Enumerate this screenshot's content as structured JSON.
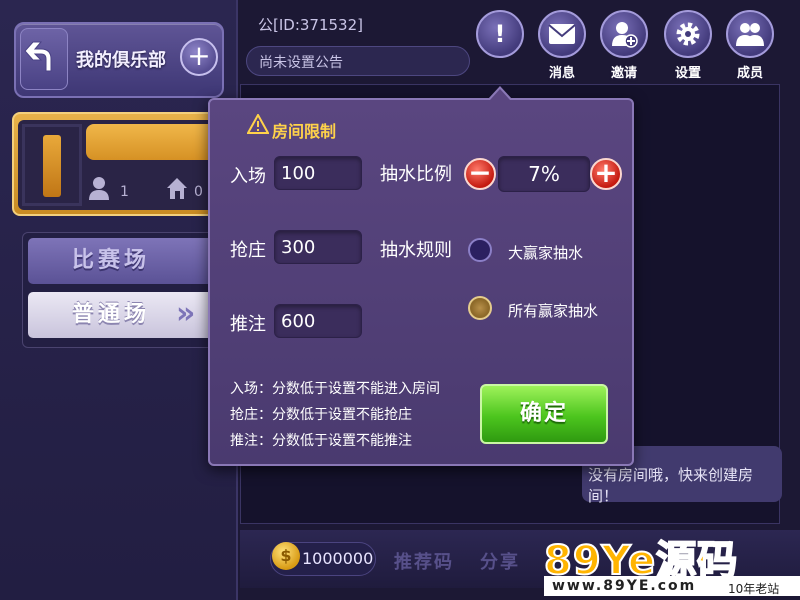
{
  "sidebar": {
    "title": "我的俱乐部",
    "member_count": "1",
    "room_count": "0",
    "modes": [
      "比赛场",
      "普通场"
    ]
  },
  "header": {
    "club_id": "公[ID:371532]",
    "announcement": "尚未设置公告",
    "icons": [
      {
        "name": "notice-icon",
        "label": ""
      },
      {
        "name": "mail-icon",
        "label": "消息"
      },
      {
        "name": "invite-icon",
        "label": "邀请"
      },
      {
        "name": "settings-icon",
        "label": "设置"
      },
      {
        "name": "members-icon",
        "label": "成员"
      }
    ]
  },
  "dialog": {
    "title": "房间限制",
    "fields": {
      "entry": {
        "label": "入场",
        "value": "100"
      },
      "banker": {
        "label": "抢庄",
        "value": "300"
      },
      "bet": {
        "label": "推注",
        "value": "600"
      }
    },
    "rake_ratio_label": "抽水比例",
    "rake_ratio_value": "7%",
    "rake_rule_label": "抽水规则",
    "rake_rules": [
      {
        "label": "大赢家抽水",
        "selected": false
      },
      {
        "label": "所有赢家抽水",
        "selected": true
      }
    ],
    "notes": [
      "入场：分数低于设置不能进入房间",
      "抢庄：分数低于设置不能抢庄",
      "推注：分数低于设置不能推注"
    ],
    "confirm_label": "确定"
  },
  "main": {
    "empty_tip": "没有房间哦，快来创建房间！",
    "coins": "1000000",
    "bottom_tabs": [
      "推荐码",
      "分享"
    ]
  },
  "watermark": {
    "brand": "89Ye源码",
    "url": "www.89YE.com",
    "tag": "10年老站"
  },
  "colors": {
    "accent_gold": "#ffd24a",
    "confirm_green": "#4cc51e",
    "panel_purple": "#4a3a6f",
    "danger_red": "#c41a10"
  }
}
